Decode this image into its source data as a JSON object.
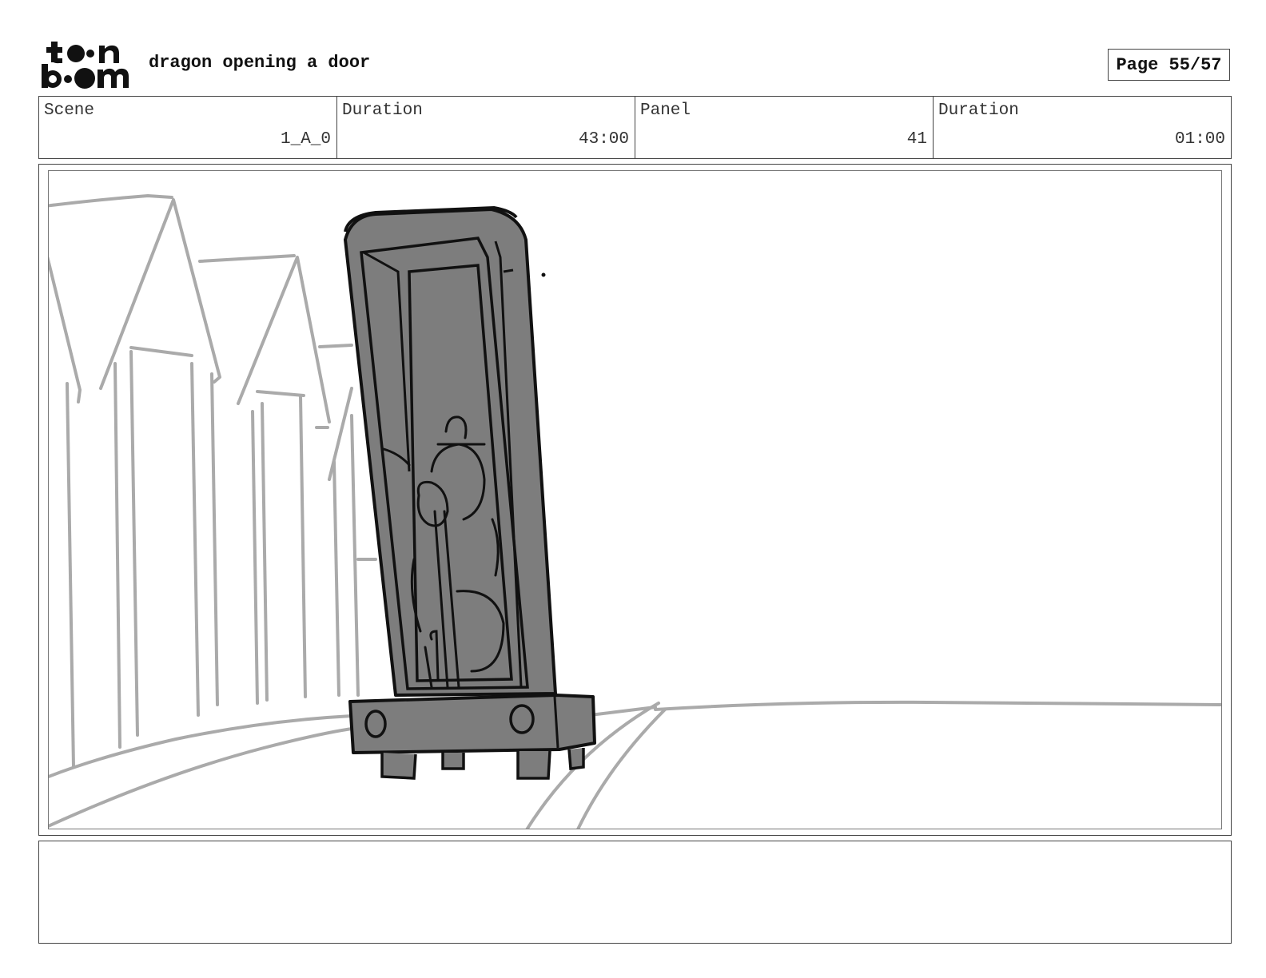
{
  "header": {
    "title": "dragon opening a door",
    "page": "Page 55/57"
  },
  "info": {
    "scene_label": "Scene",
    "scene_value": "1_A_0",
    "scene_duration_label": "Duration",
    "scene_duration_value": "43:00",
    "panel_label": "Panel",
    "panel_value": "41",
    "panel_duration_label": "Duration",
    "panel_duration_value": "01:00"
  },
  "logo": {
    "icon": "toon-boom-logo",
    "text": "toon boom"
  },
  "colors": {
    "sketch_gray": "#aaaaaa",
    "door_fill": "#7d7d7d",
    "ink": "#111111",
    "border": "#444444"
  }
}
